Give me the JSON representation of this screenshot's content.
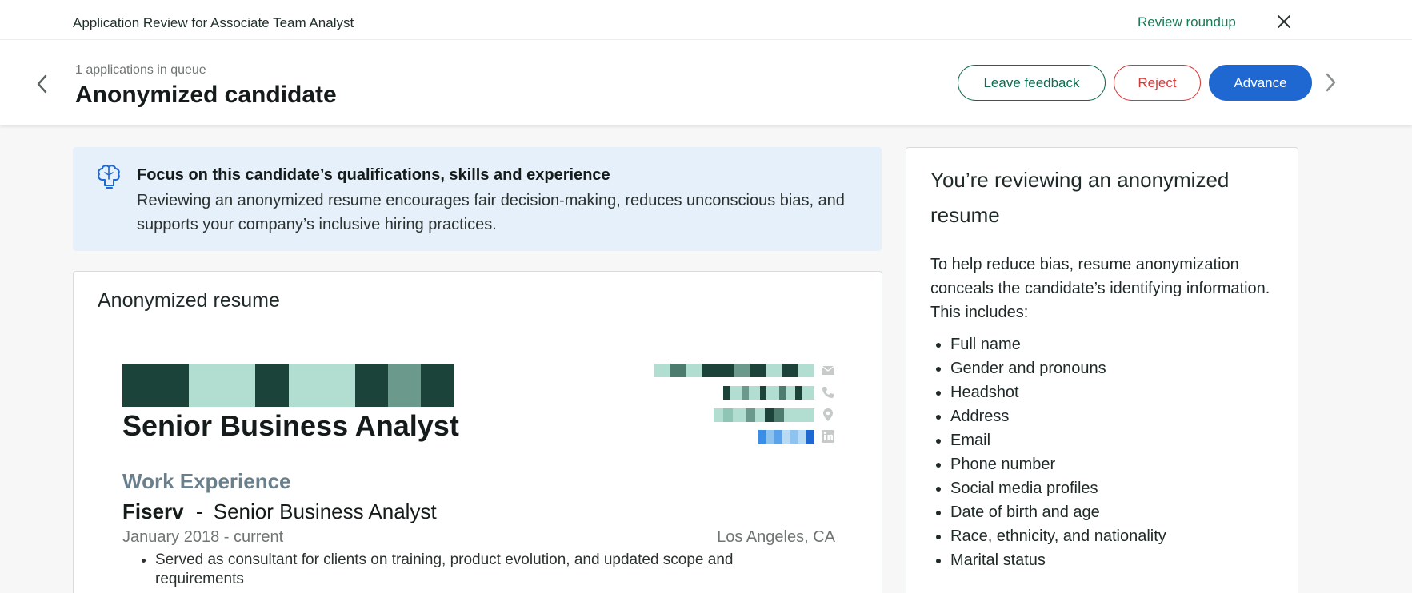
{
  "topbar": {
    "title": "Application Review for Associate Team Analyst",
    "review_roundup": "Review roundup",
    "close_icon": "close-icon"
  },
  "header": {
    "queue_text": "1 applications in queue",
    "candidate_name": "Anonymized candidate",
    "buttons": {
      "leave_feedback": "Leave feedback",
      "reject": "Reject",
      "advance": "Advance"
    }
  },
  "banner": {
    "icon": "brain-icon",
    "title": "Focus on this candidate’s qualifications, skills and experience",
    "text": "Reviewing an anonymized resume encourages fair decision-making, reduces unconscious bias, and supports your company’s inclusive hiring practices."
  },
  "resume": {
    "card_title": "Anonymized resume",
    "heading": "Senior Business Analyst",
    "section_title": "Work Experience",
    "job": {
      "company": "Fiserv",
      "separator": "-",
      "role": "Senior Business Analyst",
      "dates": "January 2018 - current",
      "location": "Los Angeles, CA",
      "bullets": [
        "Served as consultant for clients on training, product evolution, and updated scope and requirements"
      ]
    },
    "contact_icons": [
      "mail-icon",
      "phone-icon",
      "location-pin-icon",
      "linkedin-icon"
    ]
  },
  "colors": {
    "accent_green": "#0d6b4f",
    "reject_red": "#d33a3a",
    "advance_blue": "#1f67d1",
    "banner_bg": "#e5f0fb",
    "redact_dark": "#1b433a",
    "redact_light": "#b2ded1",
    "redact_mid": "#6b9a8c"
  },
  "sidebar": {
    "title": "You’re reviewing an anonymized resume",
    "description": "To help reduce bias, resume anonymization conceals the candidate’s identifying information. This includes:",
    "items": [
      "Full name",
      "Gender and pronouns",
      "Headshot",
      "Address",
      "Email",
      "Phone number",
      "Social media profiles",
      "Date of birth and age",
      "Race, ethnicity, and nationality",
      "Marital status"
    ]
  }
}
